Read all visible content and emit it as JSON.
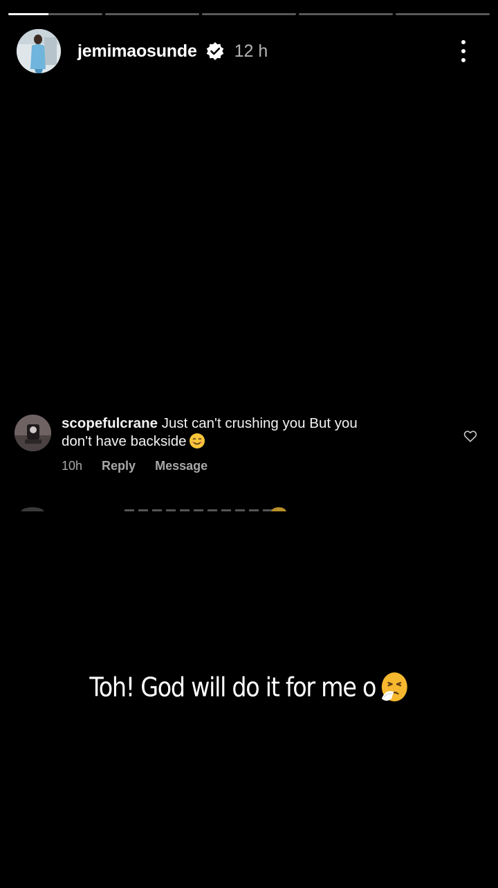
{
  "story": {
    "segments": [
      {
        "progress": 0.43
      },
      {
        "progress": 0
      },
      {
        "progress": 0
      },
      {
        "progress": 0
      },
      {
        "progress": 0
      }
    ]
  },
  "header": {
    "username": "jemimaosunde",
    "time": "12 h",
    "verified_icon": "verified-badge-icon",
    "more_icon": "more-vertical-icon"
  },
  "comment": {
    "username": "scopefulcrane",
    "text_line1": "Just can't crushing you  But you",
    "text_line2": "don't have backside",
    "emoji": "smiling-face-icon",
    "time": "10h",
    "reply_label": "Reply",
    "message_label": "Message",
    "like_icon": "heart-outline-icon"
  },
  "caption": {
    "text": "Toh! God will do it for me o",
    "emoji": "sneezing-face-icon"
  },
  "colors": {
    "background": "#000000",
    "meta_text": "#a8a8a8",
    "progress_track": "rgba(255,255,255,0.35)"
  }
}
